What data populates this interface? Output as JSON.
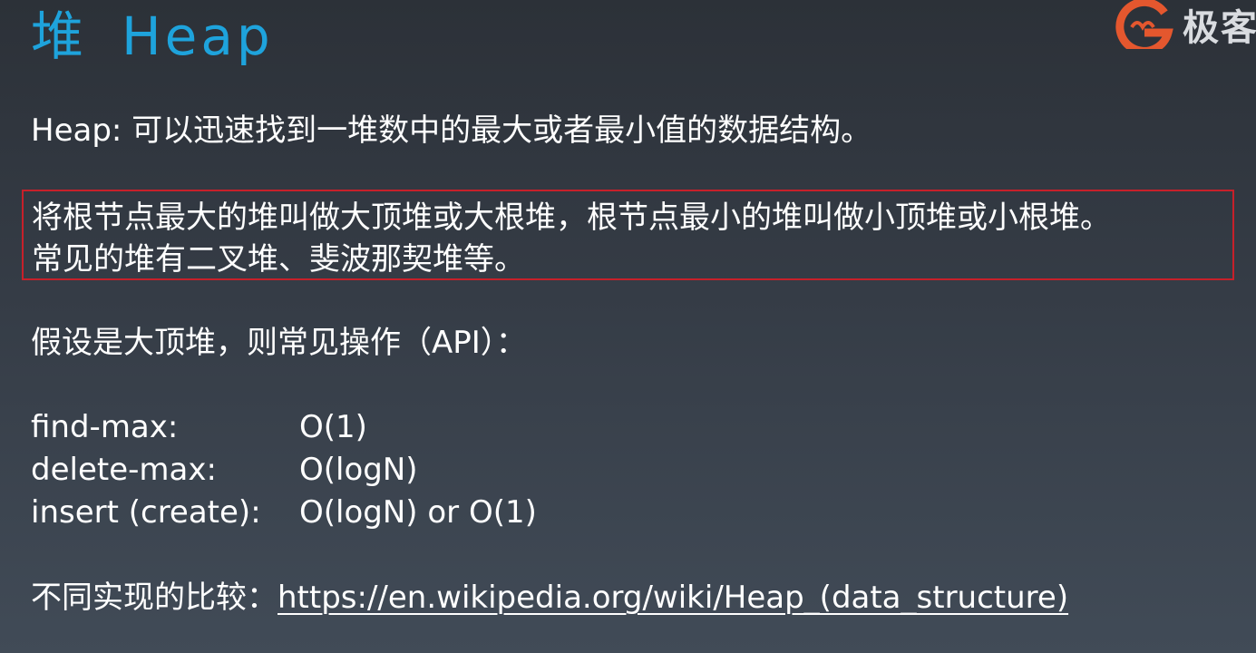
{
  "title": {
    "cn": "堆",
    "en": "Heap"
  },
  "logo": {
    "text": "极客",
    "accent": "#e4572e"
  },
  "colors": {
    "title": "#1ea3dc",
    "highlight_border": "#c7202a",
    "text": "#ffffff"
  },
  "definition": "Heap: 可以迅速找到一堆数中的最大或者最小值的数据结构。",
  "highlight": {
    "line1": "将根节点最大的堆叫做大顶堆或大根堆，根节点最小的堆叫做小顶堆或小根堆。",
    "line2": "常见的堆有二叉堆、斐波那契堆等。"
  },
  "api_intro": "假设是大顶堆，则常见操作（API）：",
  "operations": [
    {
      "name": "find-max:",
      "complexity": "O(1)"
    },
    {
      "name": "delete-max:",
      "complexity": "O(logN)"
    },
    {
      "name": "insert (create):",
      "complexity": "O(logN) or O(1)"
    }
  ],
  "comparison": {
    "label": "不同实现的比较：",
    "url": "https://en.wikipedia.org/wiki/Heap_(data_structure)"
  }
}
